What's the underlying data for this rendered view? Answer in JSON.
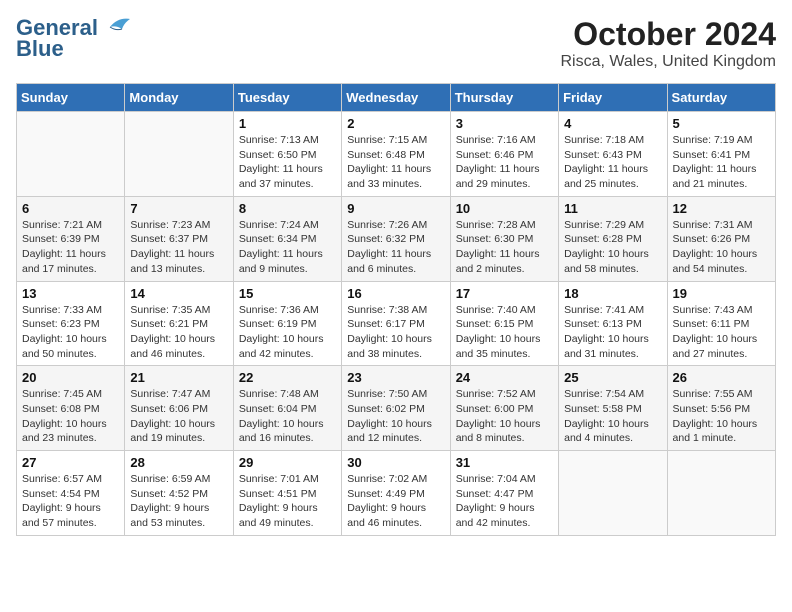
{
  "logo": {
    "line1": "General",
    "line2": "Blue"
  },
  "title": "October 2024",
  "location": "Risca, Wales, United Kingdom",
  "days_of_week": [
    "Sunday",
    "Monday",
    "Tuesday",
    "Wednesday",
    "Thursday",
    "Friday",
    "Saturday"
  ],
  "weeks": [
    [
      {
        "day": "",
        "info": ""
      },
      {
        "day": "",
        "info": ""
      },
      {
        "day": "1",
        "info": "Sunrise: 7:13 AM\nSunset: 6:50 PM\nDaylight: 11 hours\nand 37 minutes."
      },
      {
        "day": "2",
        "info": "Sunrise: 7:15 AM\nSunset: 6:48 PM\nDaylight: 11 hours\nand 33 minutes."
      },
      {
        "day": "3",
        "info": "Sunrise: 7:16 AM\nSunset: 6:46 PM\nDaylight: 11 hours\nand 29 minutes."
      },
      {
        "day": "4",
        "info": "Sunrise: 7:18 AM\nSunset: 6:43 PM\nDaylight: 11 hours\nand 25 minutes."
      },
      {
        "day": "5",
        "info": "Sunrise: 7:19 AM\nSunset: 6:41 PM\nDaylight: 11 hours\nand 21 minutes."
      }
    ],
    [
      {
        "day": "6",
        "info": "Sunrise: 7:21 AM\nSunset: 6:39 PM\nDaylight: 11 hours\nand 17 minutes."
      },
      {
        "day": "7",
        "info": "Sunrise: 7:23 AM\nSunset: 6:37 PM\nDaylight: 11 hours\nand 13 minutes."
      },
      {
        "day": "8",
        "info": "Sunrise: 7:24 AM\nSunset: 6:34 PM\nDaylight: 11 hours\nand 9 minutes."
      },
      {
        "day": "9",
        "info": "Sunrise: 7:26 AM\nSunset: 6:32 PM\nDaylight: 11 hours\nand 6 minutes."
      },
      {
        "day": "10",
        "info": "Sunrise: 7:28 AM\nSunset: 6:30 PM\nDaylight: 11 hours\nand 2 minutes."
      },
      {
        "day": "11",
        "info": "Sunrise: 7:29 AM\nSunset: 6:28 PM\nDaylight: 10 hours\nand 58 minutes."
      },
      {
        "day": "12",
        "info": "Sunrise: 7:31 AM\nSunset: 6:26 PM\nDaylight: 10 hours\nand 54 minutes."
      }
    ],
    [
      {
        "day": "13",
        "info": "Sunrise: 7:33 AM\nSunset: 6:23 PM\nDaylight: 10 hours\nand 50 minutes."
      },
      {
        "day": "14",
        "info": "Sunrise: 7:35 AM\nSunset: 6:21 PM\nDaylight: 10 hours\nand 46 minutes."
      },
      {
        "day": "15",
        "info": "Sunrise: 7:36 AM\nSunset: 6:19 PM\nDaylight: 10 hours\nand 42 minutes."
      },
      {
        "day": "16",
        "info": "Sunrise: 7:38 AM\nSunset: 6:17 PM\nDaylight: 10 hours\nand 38 minutes."
      },
      {
        "day": "17",
        "info": "Sunrise: 7:40 AM\nSunset: 6:15 PM\nDaylight: 10 hours\nand 35 minutes."
      },
      {
        "day": "18",
        "info": "Sunrise: 7:41 AM\nSunset: 6:13 PM\nDaylight: 10 hours\nand 31 minutes."
      },
      {
        "day": "19",
        "info": "Sunrise: 7:43 AM\nSunset: 6:11 PM\nDaylight: 10 hours\nand 27 minutes."
      }
    ],
    [
      {
        "day": "20",
        "info": "Sunrise: 7:45 AM\nSunset: 6:08 PM\nDaylight: 10 hours\nand 23 minutes."
      },
      {
        "day": "21",
        "info": "Sunrise: 7:47 AM\nSunset: 6:06 PM\nDaylight: 10 hours\nand 19 minutes."
      },
      {
        "day": "22",
        "info": "Sunrise: 7:48 AM\nSunset: 6:04 PM\nDaylight: 10 hours\nand 16 minutes."
      },
      {
        "day": "23",
        "info": "Sunrise: 7:50 AM\nSunset: 6:02 PM\nDaylight: 10 hours\nand 12 minutes."
      },
      {
        "day": "24",
        "info": "Sunrise: 7:52 AM\nSunset: 6:00 PM\nDaylight: 10 hours\nand 8 minutes."
      },
      {
        "day": "25",
        "info": "Sunrise: 7:54 AM\nSunset: 5:58 PM\nDaylight: 10 hours\nand 4 minutes."
      },
      {
        "day": "26",
        "info": "Sunrise: 7:55 AM\nSunset: 5:56 PM\nDaylight: 10 hours\nand 1 minute."
      }
    ],
    [
      {
        "day": "27",
        "info": "Sunrise: 6:57 AM\nSunset: 4:54 PM\nDaylight: 9 hours\nand 57 minutes."
      },
      {
        "day": "28",
        "info": "Sunrise: 6:59 AM\nSunset: 4:52 PM\nDaylight: 9 hours\nand 53 minutes."
      },
      {
        "day": "29",
        "info": "Sunrise: 7:01 AM\nSunset: 4:51 PM\nDaylight: 9 hours\nand 49 minutes."
      },
      {
        "day": "30",
        "info": "Sunrise: 7:02 AM\nSunset: 4:49 PM\nDaylight: 9 hours\nand 46 minutes."
      },
      {
        "day": "31",
        "info": "Sunrise: 7:04 AM\nSunset: 4:47 PM\nDaylight: 9 hours\nand 42 minutes."
      },
      {
        "day": "",
        "info": ""
      },
      {
        "day": "",
        "info": ""
      }
    ]
  ]
}
